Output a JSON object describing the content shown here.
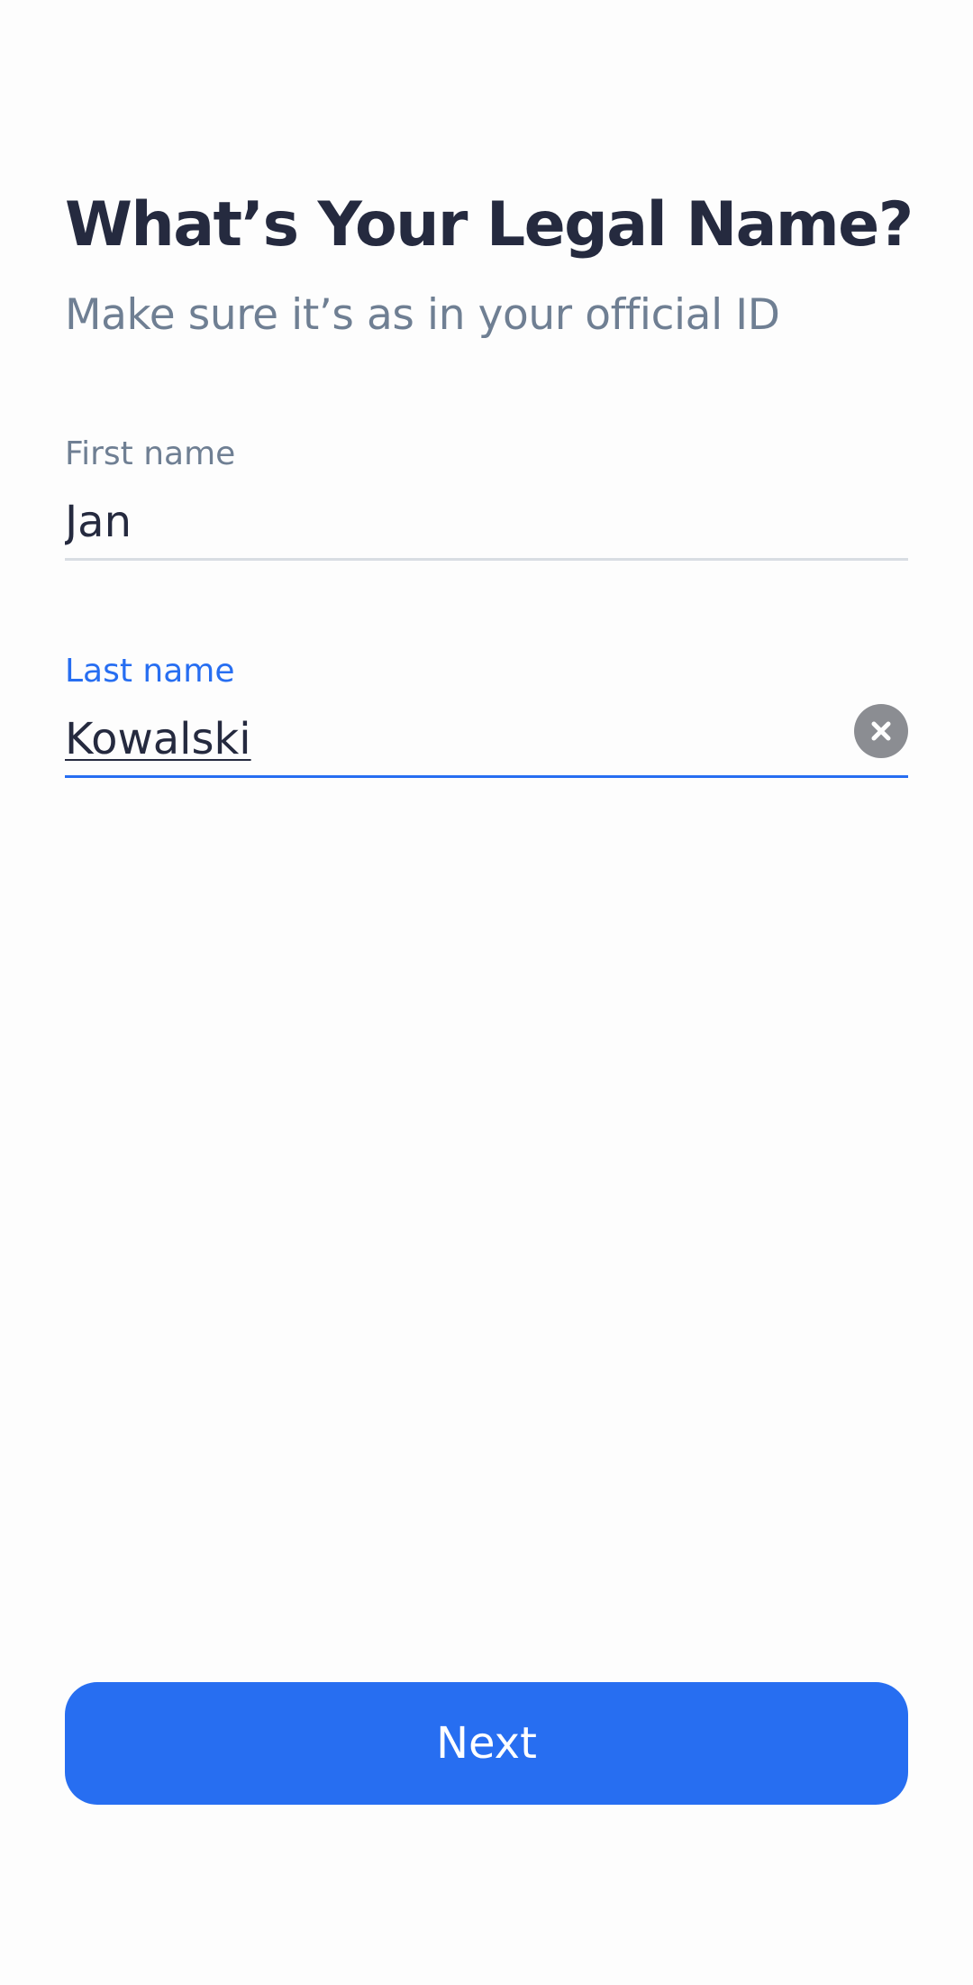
{
  "header": {
    "title": "What’s Your Legal Name?",
    "subtitle": "Make sure it’s as in your official ID"
  },
  "form": {
    "first_name": {
      "label": "First name",
      "value": "Jan"
    },
    "last_name": {
      "label": "Last name",
      "value": "Kowalski",
      "focused": true
    }
  },
  "actions": {
    "next_label": "Next"
  },
  "icons": {
    "clear": "close-icon"
  },
  "colors": {
    "accent": "#276ef1",
    "title": "#252a3f",
    "muted": "#6f7f93",
    "divider": "#d8dde3",
    "clear_badge": "#8b8d92",
    "background": "#fdfdfd"
  }
}
